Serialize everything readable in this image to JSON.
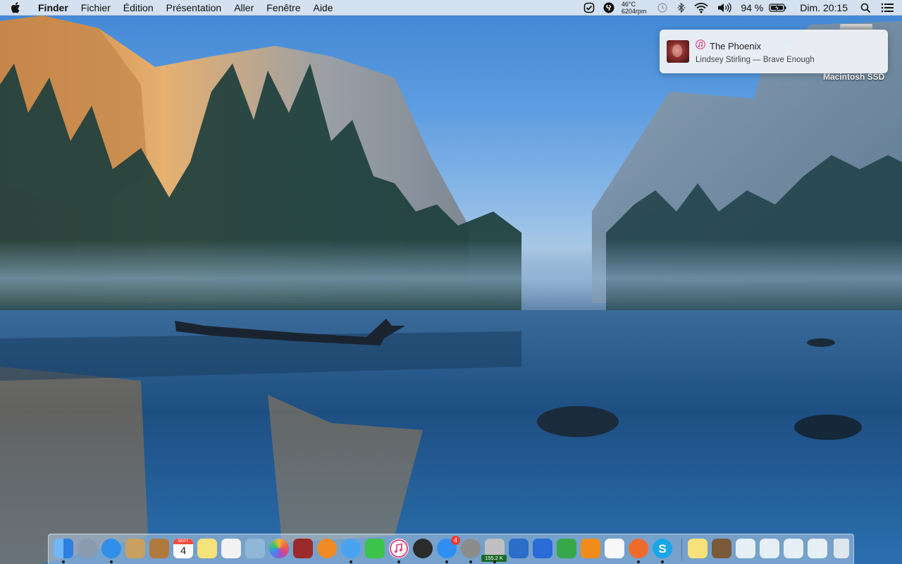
{
  "menubar": {
    "app_name": "Finder",
    "menus": [
      "Fichier",
      "Édition",
      "Présentation",
      "Aller",
      "Fenêtre",
      "Aide"
    ],
    "temperature": "46°C",
    "fan_speed": "6204rpm",
    "battery_percent": "94 %",
    "clock": "Dim. 20:15"
  },
  "notification": {
    "title": "The Phoenix",
    "subtitle": "Lindsey Stirling — Brave Enough",
    "app_icon": "music-note-icon"
  },
  "desktop": {
    "disk_label": "Macintosh SSD"
  },
  "dock": {
    "calendar_month": "SEPT",
    "calendar_day": "4",
    "app_store_badge": "4",
    "network_meter": "155,2 K",
    "items": [
      {
        "name": "finder",
        "color": "#3e8ee8"
      },
      {
        "name": "launchpad",
        "color": "#8a9bb0"
      },
      {
        "name": "safari",
        "color": "#2f8ee8"
      },
      {
        "name": "mail-stamp",
        "color": "#c8a060"
      },
      {
        "name": "contacts",
        "color": "#b07a3e"
      },
      {
        "name": "calendar",
        "color": "#ffffff"
      },
      {
        "name": "notes",
        "color": "#f6e27a"
      },
      {
        "name": "reminders",
        "color": "#f2f2f2"
      },
      {
        "name": "preview",
        "color": "#8fb7d8"
      },
      {
        "name": "photos",
        "color": "#ffffff"
      },
      {
        "name": "photo-booth",
        "color": "#9b2a2a"
      },
      {
        "name": "ibooks",
        "color": "#f08a24"
      },
      {
        "name": "messages",
        "color": "#4aa3f0"
      },
      {
        "name": "facetime",
        "color": "#3cc34b"
      },
      {
        "name": "itunes",
        "color": "#ffffff"
      },
      {
        "name": "quicktime",
        "color": "#2b2b2b"
      },
      {
        "name": "app-store",
        "color": "#2e8ff0"
      },
      {
        "name": "system-preferences",
        "color": "#8c8c8c"
      },
      {
        "name": "disk-utility",
        "color": "#c0c0c0"
      },
      {
        "name": "keynote-dev",
        "color": "#2a6ec8"
      },
      {
        "name": "keynote",
        "color": "#2b6bd8"
      },
      {
        "name": "numbers",
        "color": "#37a84a"
      },
      {
        "name": "pages",
        "color": "#f08c1c"
      },
      {
        "name": "textedit",
        "color": "#f7f7f7"
      },
      {
        "name": "maps",
        "color": "#f06a2c"
      },
      {
        "name": "skype",
        "color": "#18a6e8"
      },
      {
        "name": "stickies",
        "color": "#f7e27a"
      },
      {
        "name": "image-stack",
        "color": "#7a5a3a"
      },
      {
        "name": "window-stack-1",
        "color": "#e6eef6"
      },
      {
        "name": "window-stack-2",
        "color": "#e6eef6"
      },
      {
        "name": "window-stack-3",
        "color": "#e6eef6"
      },
      {
        "name": "window-stack-4",
        "color": "#e6eef6"
      },
      {
        "name": "trash",
        "color": "#dfe6ec"
      }
    ]
  }
}
